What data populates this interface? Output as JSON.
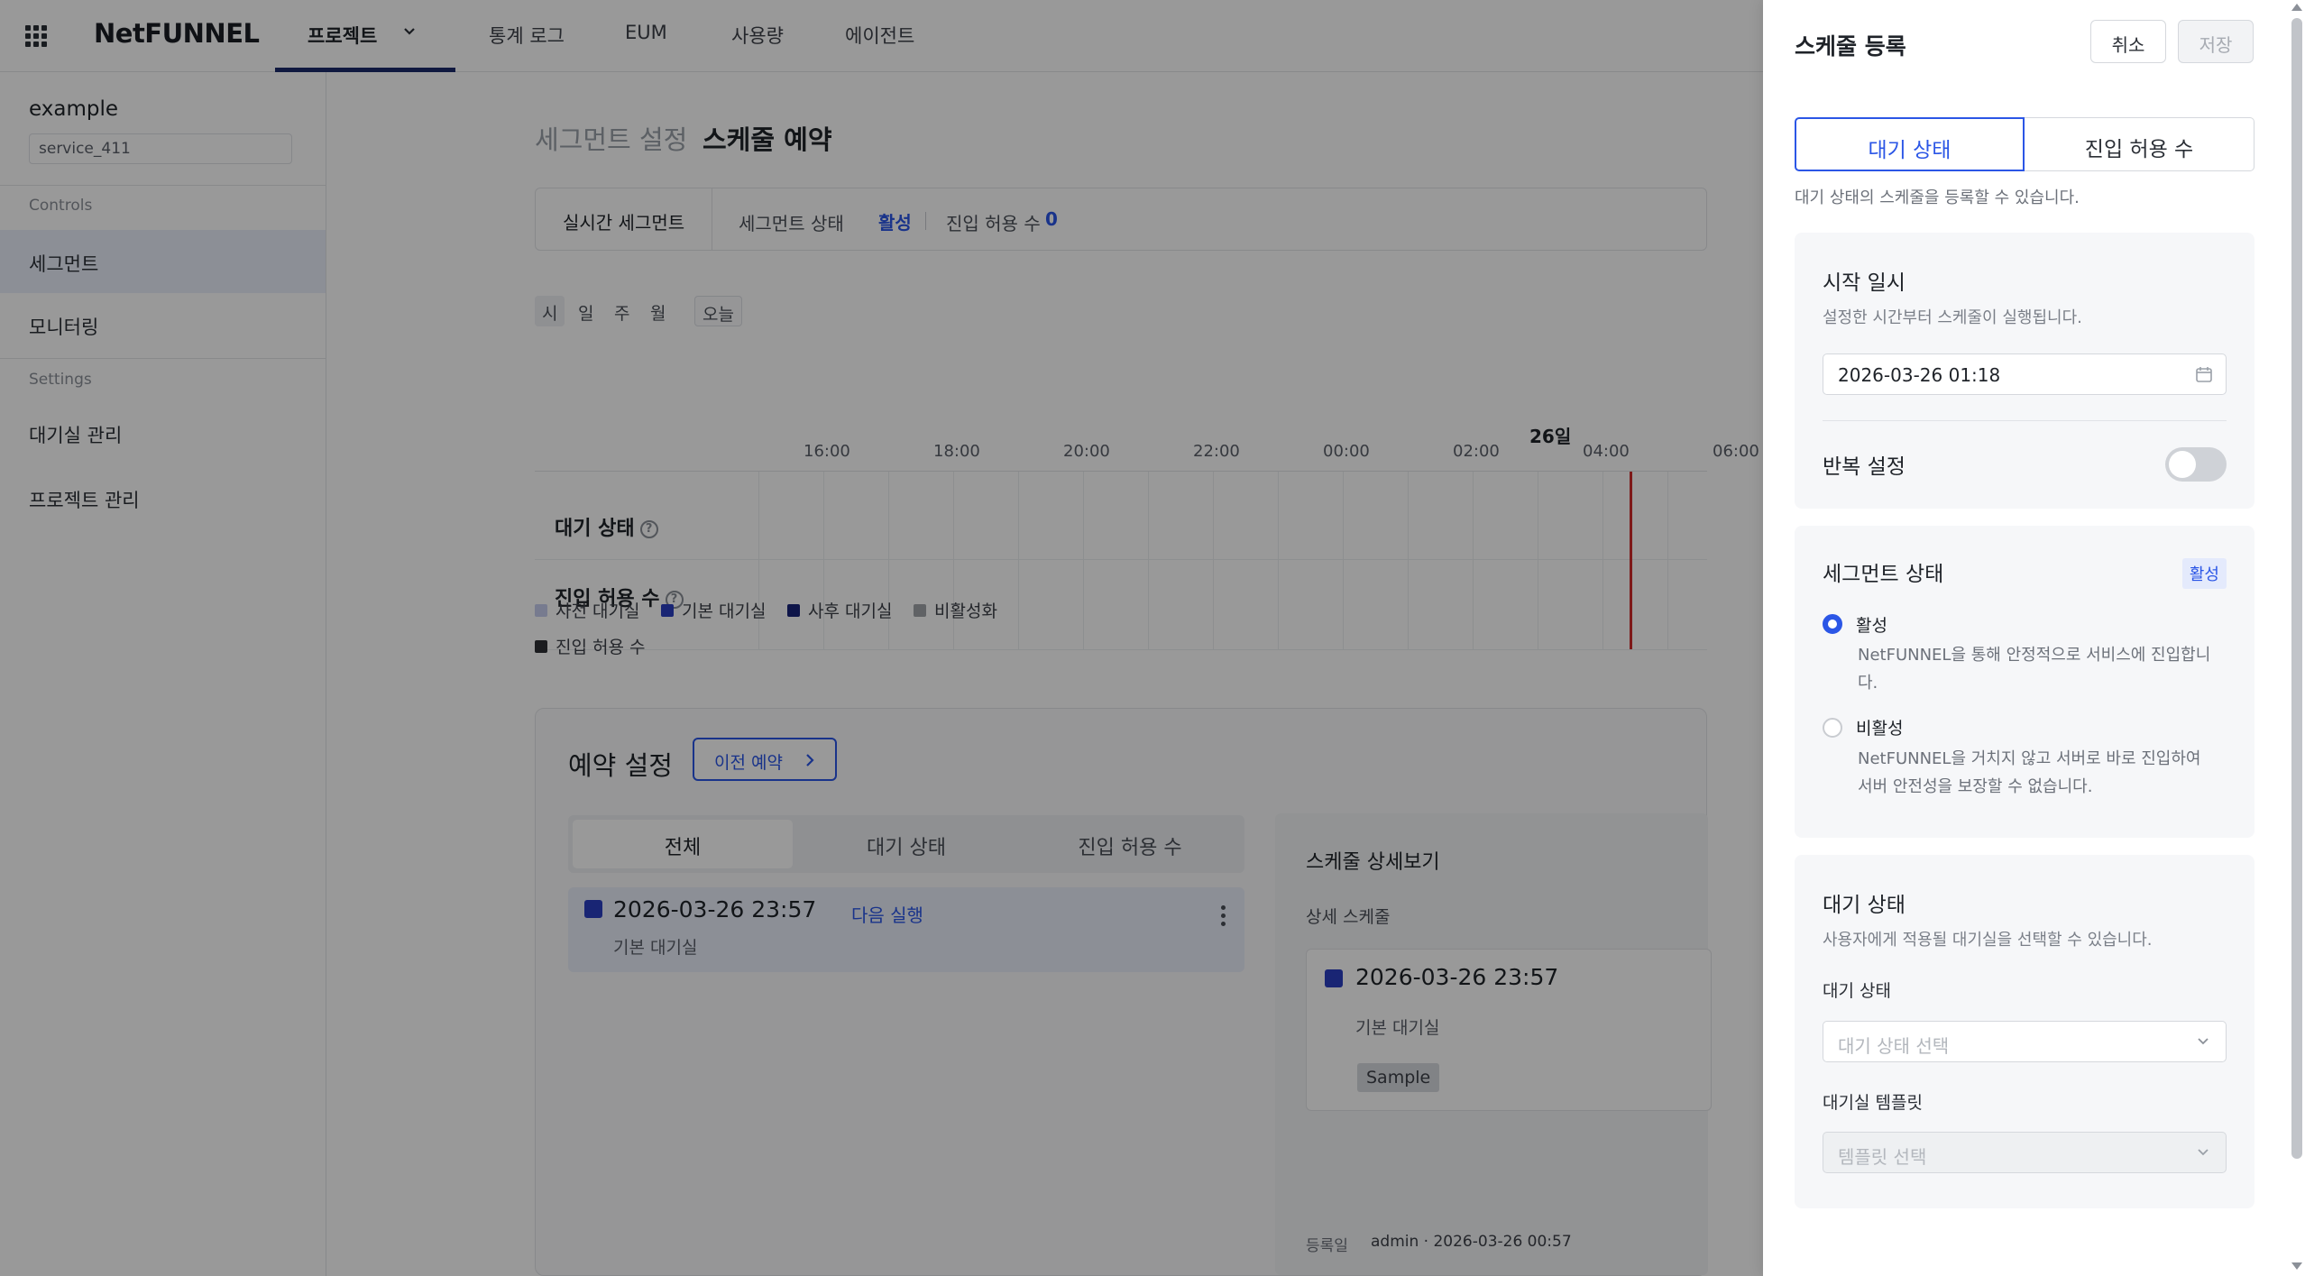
{
  "header": {
    "logo": "NetFUNNEL",
    "nav": [
      "프로젝트",
      "통계 로그",
      "EUM",
      "사용량",
      "에이전트"
    ]
  },
  "sidebar": {
    "project_name": "example",
    "service": "service_411",
    "group_controls": "Controls",
    "group_settings": "Settings",
    "items": [
      "세그먼트",
      "모니터링",
      "대기실 관리",
      "프로젝트 관리"
    ]
  },
  "main": {
    "breadcrumb": [
      "세그먼트 설정",
      "스케줄 예약"
    ],
    "segment_bar": {
      "title": "실시간 세그먼트",
      "status_label": "세그먼트 상태",
      "status_value": "활성",
      "allow_label": "진입 허용 수",
      "allow_value": "0"
    },
    "ranges": [
      "시",
      "일",
      "주",
      "월",
      "오늘"
    ],
    "timeline": {
      "day_label": "26일",
      "ticks": [
        "16:00",
        "18:00",
        "20:00",
        "22:00",
        "00:00",
        "02:00",
        "04:00",
        "06:00"
      ],
      "rows": [
        "대기 상태",
        "진입 허용 수"
      ],
      "help": "?"
    },
    "legend": [
      {
        "label": "사전 대기실",
        "color": "#c7cdef"
      },
      {
        "label": "기본 대기실",
        "color": "#2b3ec2"
      },
      {
        "label": "사후 대기실",
        "color": "#18237a"
      },
      {
        "label": "비활성화",
        "color": "#a0a3a8"
      },
      {
        "label": "진입 허용 수",
        "color": "#2e3035"
      }
    ],
    "reservation": {
      "title": "예약 설정",
      "prev_button": "이전 예약",
      "tabs": [
        "전체",
        "대기 상태",
        "진입 허용 수"
      ],
      "item": {
        "datetime": "2026-03-26 23:57",
        "next_label": "다음 실행",
        "room": "기본 대기실"
      },
      "detail": {
        "title": "스케줄 상세보기",
        "sub": "상세 스케줄",
        "datetime": "2026-03-26 23:57",
        "room": "기본 대기실",
        "tag": "Sample",
        "registered_label": "등록일",
        "registered_value": "admin · 2026-03-26 00:57"
      }
    }
  },
  "drawer": {
    "title": "스케줄 등록",
    "cancel": "취소",
    "save": "저장",
    "toggle": [
      "대기 상태",
      "진입 허용 수"
    ],
    "hint": "대기 상태의 스케줄을 등록할 수 있습니다.",
    "start": {
      "title": "시작 일시",
      "sub": "설정한 시간부터 스케줄이 실행됩니다.",
      "value": "2026-03-26 01:18",
      "repeat_label": "반복 설정",
      "repeat_on": false
    },
    "segment_status": {
      "title": "세그먼트 상태",
      "badge": "활성",
      "options": [
        {
          "label": "활성",
          "desc": "NetFUNNEL을 통해 안정적으로 서비스에 진입합니다.",
          "selected": true
        },
        {
          "label": "비활성",
          "desc": "NetFUNNEL을 거치지 않고 서버로 바로 진입하여 서버 안전성을 보장할 수 없습니다.",
          "selected": false
        }
      ]
    },
    "wait_state": {
      "title": "대기 상태",
      "sub": "사용자에게 적용될 대기실을 선택할 수 있습니다.",
      "field_label": "대기 상태",
      "placeholder": "대기 상태 선택",
      "template_label": "대기실 템플릿",
      "template_placeholder": "템플릿 선택"
    }
  }
}
